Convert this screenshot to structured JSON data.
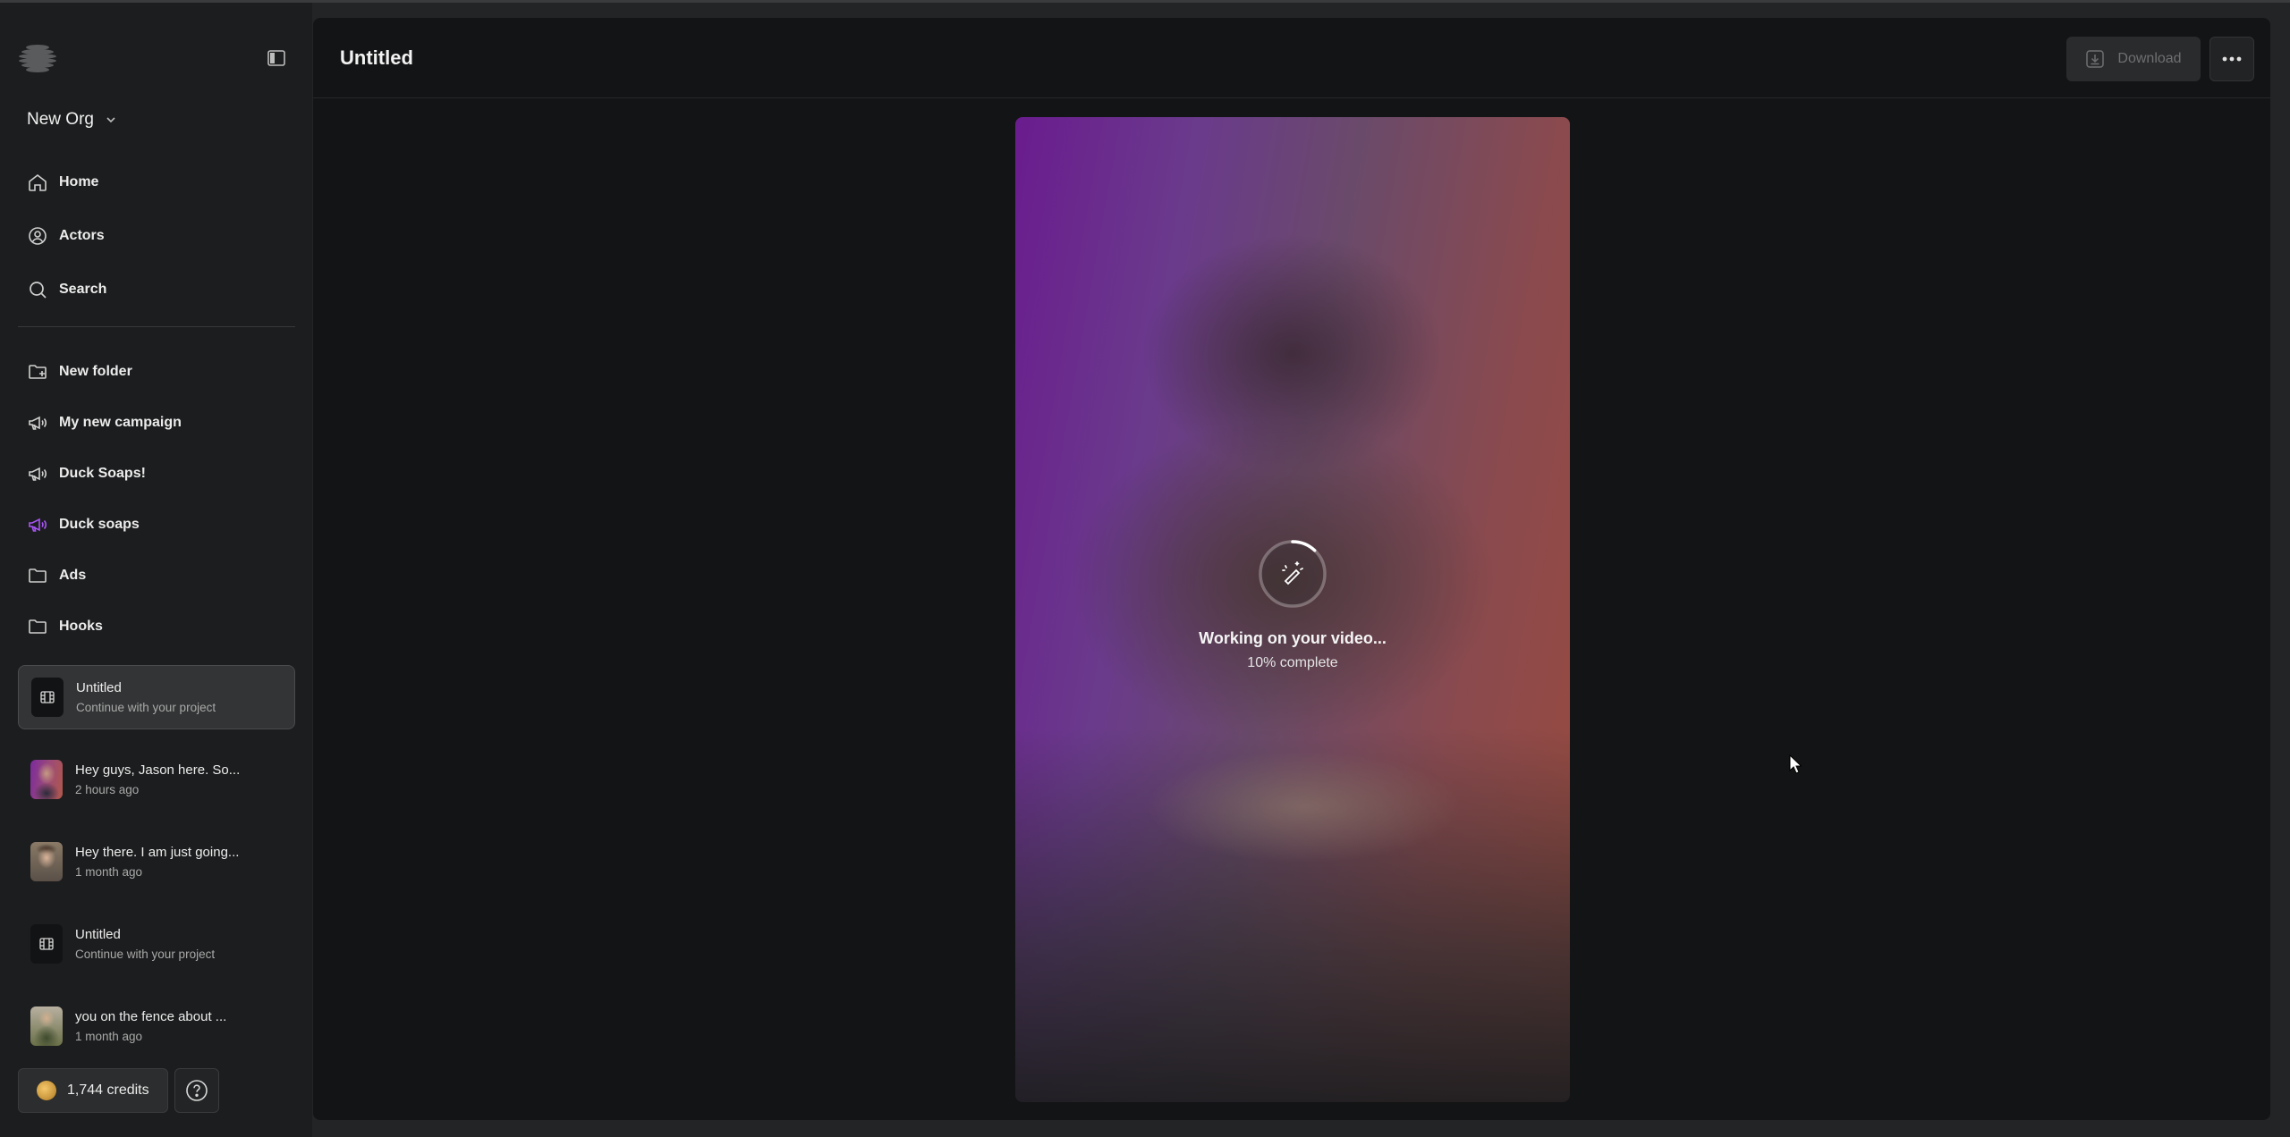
{
  "sidebar": {
    "org_name": "New Org",
    "nav": [
      {
        "label": "Home",
        "icon": "home-icon"
      },
      {
        "label": "Actors",
        "icon": "user-circle-icon"
      },
      {
        "label": "Search",
        "icon": "search-icon"
      }
    ],
    "folders": [
      {
        "label": "New folder",
        "icon": "folder-plus-icon"
      },
      {
        "label": "My new campaign",
        "icon": "megaphone-icon"
      },
      {
        "label": "Duck Soaps!",
        "icon": "megaphone-icon"
      },
      {
        "label": "Duck soaps",
        "icon": "megaphone-icon",
        "color": "#a855f7"
      },
      {
        "label": "Ads",
        "icon": "folder-icon"
      },
      {
        "label": "Hooks",
        "icon": "folder-icon"
      }
    ],
    "projects": [
      {
        "title": "Untitled",
        "subtitle": "Continue with your project",
        "active": true
      },
      {
        "title": "Hey guys, Jason here. So...",
        "subtitle": "2 hours ago"
      },
      {
        "title": "Hey there. I am just going...",
        "subtitle": "1 month ago"
      },
      {
        "title": "Untitled",
        "subtitle": "Continue with your project"
      },
      {
        "title": "you on the fence about ...",
        "subtitle": "1 month ago"
      }
    ],
    "credits": "1,744 credits"
  },
  "header": {
    "title": "Untitled",
    "download_label": "Download"
  },
  "video": {
    "status_title": "Working on your video...",
    "status_sub": "10% complete",
    "progress": 0.1
  },
  "colors": {
    "accent_purple": "#a855f7",
    "background": "#131415"
  }
}
